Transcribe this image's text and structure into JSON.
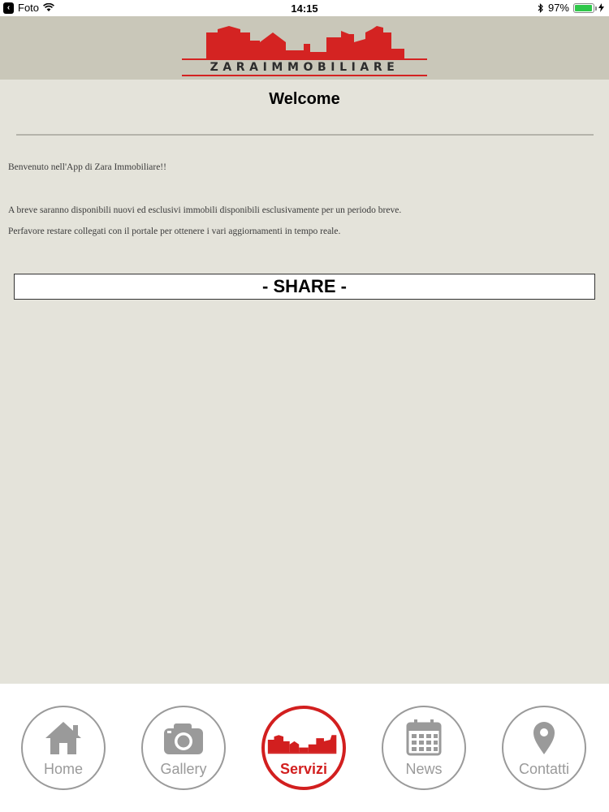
{
  "status_bar": {
    "back_app": "Foto",
    "time": "14:15",
    "battery": "97%",
    "battery_level": 0.97
  },
  "header": {
    "logo_text": "ZARAIMMOBILIARE"
  },
  "main": {
    "title": "Welcome",
    "paragraphs": [
      "Benvenuto nell'App di Zara Immobiliare!!",
      "A breve saranno disponibili nuovi ed esclusivi immobili disponibili esclusivamente per un periodo breve.",
      "Perfavore restare collegati con il portale per ottenere i vari aggiornamenti in tempo reale."
    ],
    "share_label": "- SHARE -"
  },
  "tabbar": {
    "items": [
      {
        "label": "Home",
        "icon": "home-icon"
      },
      {
        "label": "Gallery",
        "icon": "camera-icon"
      },
      {
        "label": "Servizi",
        "icon": "skyline-icon",
        "active": true
      },
      {
        "label": "News",
        "icon": "calendar-icon"
      },
      {
        "label": "Contatti",
        "icon": "location-pin-icon"
      }
    ]
  },
  "colors": {
    "brand_red": "#d42322",
    "background": "#e4e3da",
    "header_bg": "#c9c7b9"
  }
}
